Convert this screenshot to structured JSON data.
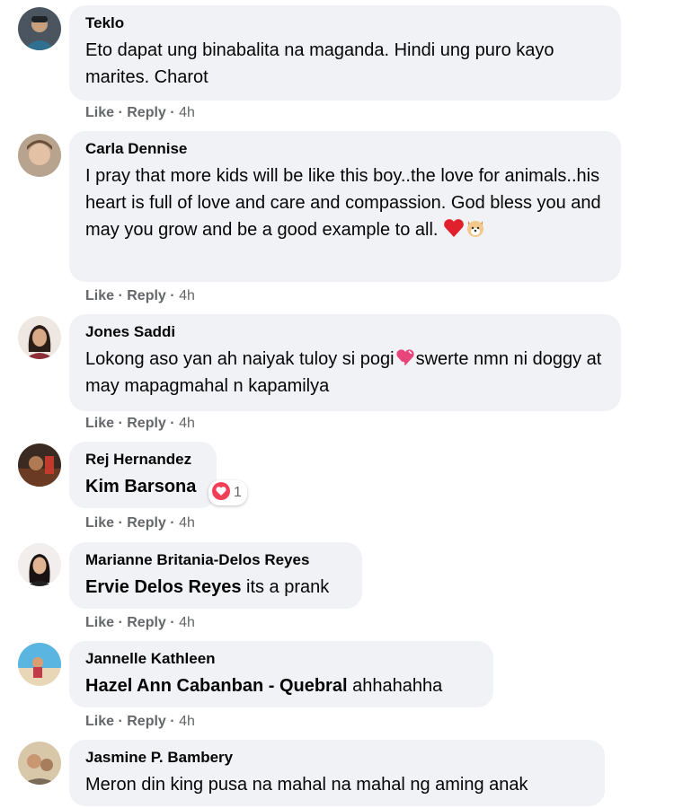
{
  "comments": [
    {
      "author": "Teklo",
      "text": "Eto dapat ung binabalita na maganda. Hindi ung puro kayo marites. Charot",
      "like": "Like",
      "reply": "Reply",
      "time": "4h"
    },
    {
      "author": "Carla Dennise",
      "text": "I pray that more kids will be like this boy..the love for animals..his heart is full of love and care and compassion. God bless you and may you grow and be a good example to all.",
      "like": "Like",
      "reply": "Reply",
      "time": "4h"
    },
    {
      "author": "Jones Saddi",
      "text_a": "Lokong aso yan ah naiyak tuloy si pogi",
      "text_b": "swerte nmn ni doggy at may mapagmahal n kapamilya",
      "like": "Like",
      "reply": "Reply",
      "time": "4h"
    },
    {
      "author": "Rej Hernandez",
      "mention": "Kim Barsona",
      "reaction_count": "1",
      "like": "Like",
      "reply": "Reply",
      "time": "4h"
    },
    {
      "author": "Marianne Britania-Delos Reyes",
      "mention": "Ervie Delos Reyes",
      "text": "its a prank",
      "like": "Like",
      "reply": "Reply",
      "time": "4h"
    },
    {
      "author": "Jannelle Kathleen",
      "mention": "Hazel Ann Cabanban - Quebral",
      "text": "ahhahahha",
      "like": "Like",
      "reply": "Reply",
      "time": "4h"
    },
    {
      "author": "Jasmine P. Bambery",
      "text": "Meron din king pusa na mahal na mahal ng aming anak"
    }
  ],
  "separator": "·",
  "colors": {
    "bubble": "#f0f2f5",
    "meta": "#65676b",
    "love": "#f33e58"
  },
  "icons": [
    "heart-emoji-icon",
    "dog-face-emoji-icon",
    "sparkling-heart-emoji-icon",
    "love-reaction-icon"
  ]
}
